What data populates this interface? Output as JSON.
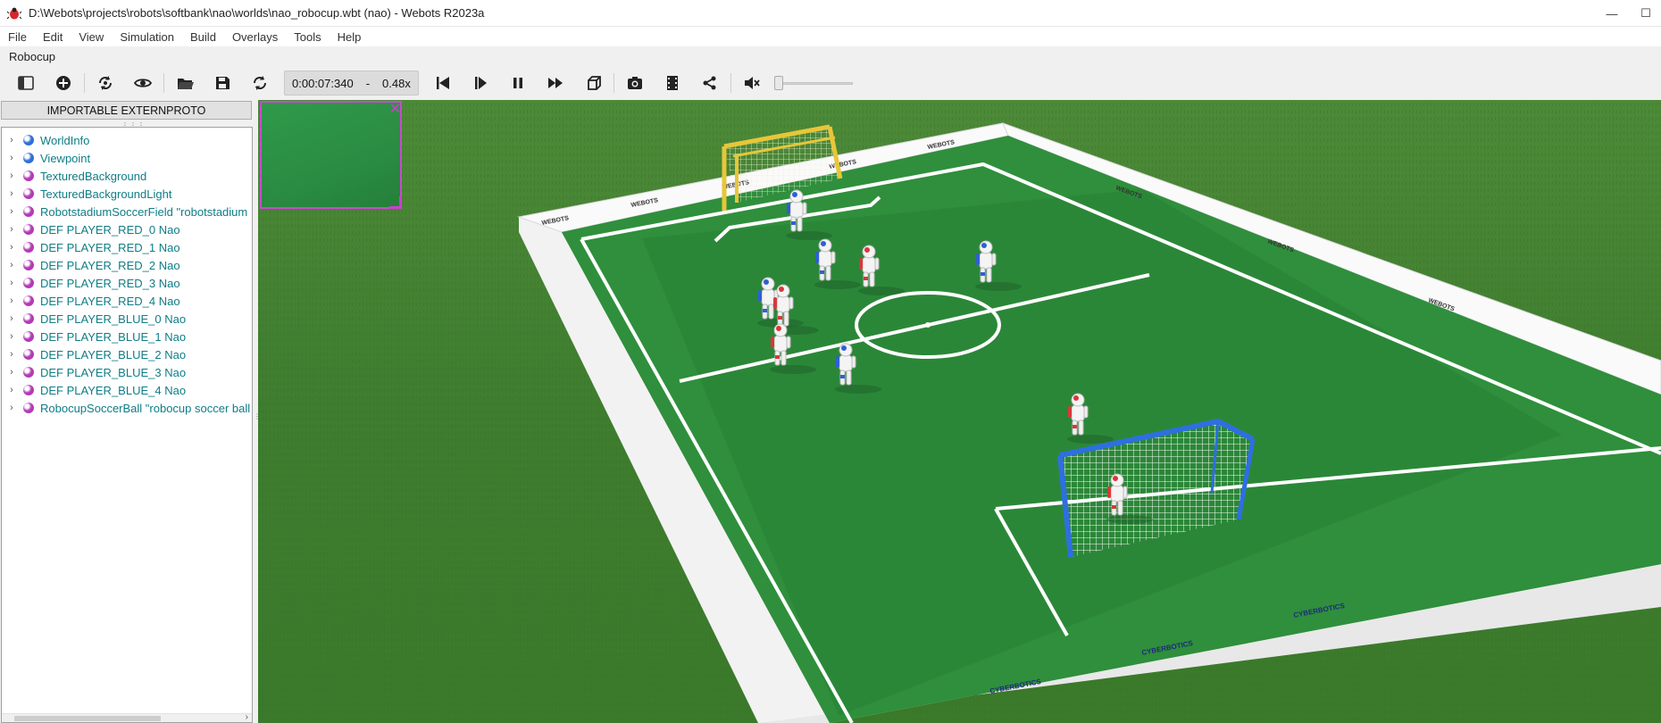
{
  "window": {
    "title": "D:\\Webots\\projects\\robots\\softbank\\nao\\worlds\\nao_robocup.wbt (nao) - Webots R2023a",
    "minimize_label": "—",
    "maximize_label": "☐"
  },
  "menu": [
    "File",
    "Edit",
    "View",
    "Simulation",
    "Build",
    "Overlays",
    "Tools",
    "Help"
  ],
  "panel_title": "Robocup",
  "toolbar": {
    "time": "0:00:07:340",
    "time_separator": "-",
    "speed": "0.48x",
    "icons": [
      "toggle-scene-tree-icon",
      "add-node-icon",
      "reload-icon",
      "view-icon",
      "open-icon",
      "save-icon",
      "reset-icon",
      "step-back-icon",
      "step-icon",
      "pause-icon",
      "fast-forward-icon",
      "render-icon",
      "screenshot-icon",
      "record-icon",
      "share-icon",
      "mute-icon"
    ],
    "volume": 0.0
  },
  "scene_tree": {
    "proto_button": "IMPORTABLE EXTERNPROTO",
    "nodes": [
      {
        "label": "WorldInfo",
        "color": "#2f6fd6"
      },
      {
        "label": "Viewpoint",
        "color": "#2f6fd6"
      },
      {
        "label": "TexturedBackground",
        "color": "#b23ab8"
      },
      {
        "label": "TexturedBackgroundLight",
        "color": "#b23ab8"
      },
      {
        "label": "RobotstadiumSoccerField \"robotstadium",
        "color": "#b23ab8"
      },
      {
        "label": "DEF PLAYER_RED_0 Nao",
        "color": "#b23ab8"
      },
      {
        "label": "DEF PLAYER_RED_1 Nao",
        "color": "#b23ab8"
      },
      {
        "label": "DEF PLAYER_RED_2 Nao",
        "color": "#b23ab8"
      },
      {
        "label": "DEF PLAYER_RED_3 Nao",
        "color": "#b23ab8"
      },
      {
        "label": "DEF PLAYER_RED_4 Nao",
        "color": "#b23ab8"
      },
      {
        "label": "DEF PLAYER_BLUE_0 Nao",
        "color": "#b23ab8"
      },
      {
        "label": "DEF PLAYER_BLUE_1 Nao",
        "color": "#b23ab8"
      },
      {
        "label": "DEF PLAYER_BLUE_2 Nao",
        "color": "#b23ab8"
      },
      {
        "label": "DEF PLAYER_BLUE_3 Nao",
        "color": "#b23ab8"
      },
      {
        "label": "DEF PLAYER_BLUE_4 Nao",
        "color": "#b23ab8"
      },
      {
        "label": "RobocupSoccerBall \"robocup soccer ball",
        "color": "#b23ab8"
      }
    ]
  },
  "viewport": {
    "board_text": "WEBOTS",
    "sponsor_text": "CYBERBOTICS",
    "colors": {
      "grass": "#3d7f2c",
      "field": "#2f8f3c",
      "field_dark": "#2a8236",
      "lines": "#ffffff",
      "yellow_goal": "#e7c63a",
      "blue_goal": "#2e6fe0",
      "red_robot": "#d8383a",
      "blue_robot": "#2e5fd6"
    }
  }
}
